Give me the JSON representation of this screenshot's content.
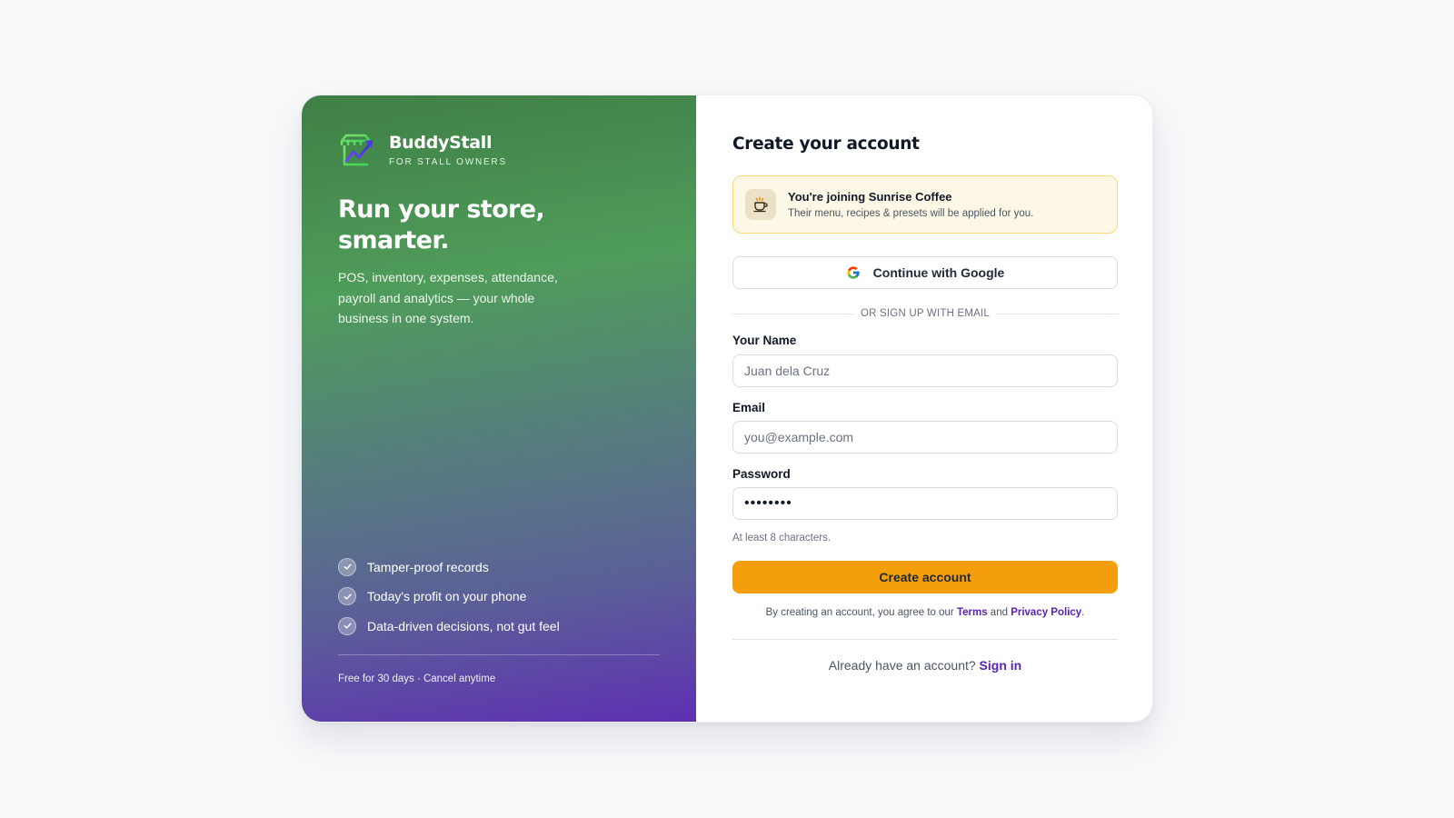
{
  "brand": {
    "name": "BuddyStall",
    "tagline": "FOR STALL OWNERS"
  },
  "hero": {
    "headline": "Run your store, smarter.",
    "subhead": "POS, inventory, expenses, attendance, payroll and analytics — your whole business in one system."
  },
  "features": [
    {
      "label": "Tamper-proof records",
      "icon": "check-icon"
    },
    {
      "label": "Today's profit on your phone",
      "icon": "check-icon"
    },
    {
      "label": "Data-driven decisions, not gut feel",
      "icon": "check-icon"
    }
  ],
  "trial_note": "Free for 30 days · Cancel anytime",
  "form": {
    "title": "Create your account",
    "invite": {
      "title": "You're joining Sunrise Coffee",
      "subtitle": "Their menu, recipes & presets will be applied for you.",
      "icon": "coffee-shop-icon"
    },
    "google_button": "Continue with Google",
    "divider_text": "OR SIGN UP WITH EMAIL",
    "name_label": "Your Name",
    "name_placeholder": "Juan dela Cruz",
    "email_label": "Email",
    "email_placeholder": "you@example.com",
    "password_label": "Password",
    "password_value": "abcdefgh",
    "password_hint": "At least 8 characters.",
    "submit_button": "Create account",
    "terms_prefix": "By creating an account, you agree to our ",
    "terms_link": "Terms",
    "terms_and": " and ",
    "privacy_link": "Privacy Policy",
    "terms_suffix": ".",
    "signin_prompt": "Already have an account? ",
    "signin_link": "Sign in"
  },
  "colors": {
    "accent_button": "#f59e0b",
    "link": "#5b21b6",
    "gradient_top": "#3f7f45",
    "gradient_bottom": "#5e30b2"
  }
}
